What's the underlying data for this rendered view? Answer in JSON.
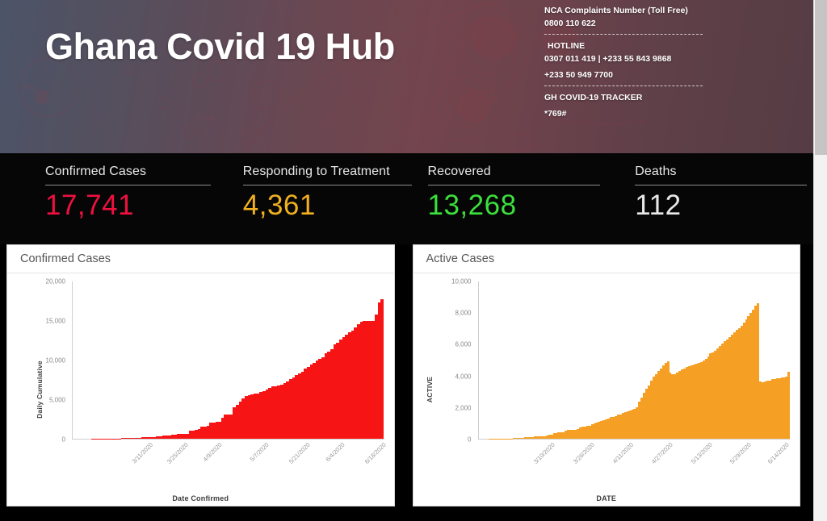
{
  "header": {
    "title": "Ghana Covid 19 Hub",
    "contact": {
      "nca_label": "NCA Complaints Number (Toll Free)",
      "nca_number": "0800 110 622",
      "hotline_label": " HOTLINE",
      "hotline_numbers": "0307 011 419  |    +233 55 843 9868",
      "hotline_extra": "+233 50 949 7700",
      "tracker_label": "GH COVID-19 TRACKER",
      "tracker_code": "*769#"
    }
  },
  "stats": [
    {
      "label": "Confirmed Cases",
      "value": "17,741",
      "color": "#f01040"
    },
    {
      "label": "Responding to Treatment",
      "value": "4,361",
      "color": "#f0b020"
    },
    {
      "label": "Recovered",
      "value": "13,268",
      "color": "#3ce03c"
    },
    {
      "label": "Deaths",
      "value": "112",
      "color": "#e8e8e8"
    }
  ],
  "cards": [
    {
      "title": "Confirmed Cases"
    },
    {
      "title": "Active Cases"
    }
  ],
  "chart_data": [
    {
      "type": "bar",
      "title": "Confirmed Cases",
      "xlabel": "Date Confirmed",
      "ylabel": "Daily Cumulative",
      "ylim": [
        0,
        20000
      ],
      "yticks": [
        "0",
        "5,000",
        "10,000",
        "15,000",
        "20,000"
      ],
      "ytick_values": [
        0,
        5000,
        10000,
        15000,
        20000
      ],
      "xticks": [
        "3/11/2020",
        "3/25/2020",
        "4/9/2020",
        "5/7/2020",
        "5/21/2020",
        "6/4/2020",
        "6/18/2020"
      ],
      "xtick_positions": [
        0.035,
        0.165,
        0.3,
        0.475,
        0.615,
        0.755,
        0.895
      ],
      "grid": false,
      "legend": false,
      "color": "#f61414",
      "values": [
        2,
        3,
        4,
        6,
        7,
        8,
        9,
        11,
        12,
        16,
        19,
        21,
        24,
        27,
        33,
        40,
        53,
        68,
        93,
        108,
        132,
        141,
        152,
        161,
        168,
        195,
        205,
        214,
        287,
        313,
        378,
        408,
        442,
        468,
        494,
        566,
        614,
        636,
        641,
        1042,
        1042,
        1154,
        1279,
        1550,
        1550,
        1671,
        2074,
        2074,
        2169,
        2169,
        2719,
        3091,
        3091,
        3091,
        4012,
        4263,
        4700,
        5127,
        5408,
        5530,
        5638,
        5735,
        5735,
        5918,
        6096,
        6269,
        6486,
        6617,
        6683,
        6808,
        6864,
        7117,
        7303,
        7616,
        7768,
        8070,
        8297,
        8548,
        8885,
        9168,
        9462,
        9638,
        9910,
        10201,
        10358,
        10856,
        11118,
        11422,
        11964,
        12193,
        12590,
        12929,
        13203,
        13556,
        13717,
        14154,
        14568,
        14883,
        15013,
        15013,
        15013,
        15013,
        15834,
        17351,
        17741
      ]
    },
    {
      "type": "bar",
      "title": "Active Cases",
      "xlabel": "DATE",
      "ylabel": "ACTIVE",
      "ylim": [
        0,
        10000
      ],
      "yticks": [
        "0",
        "2,000",
        "4,000",
        "6,000",
        "8,000",
        "10,000"
      ],
      "ytick_values": [
        0,
        2000,
        4000,
        6000,
        8000,
        10000
      ],
      "xticks": [
        "3/10/2020",
        "3/26/2020",
        "4/11/2020",
        "4/27/2020",
        "5/13/2020",
        "5/29/2020",
        "6/14/2020"
      ],
      "xtick_positions": [
        0.02,
        0.165,
        0.31,
        0.455,
        0.6,
        0.745,
        0.885
      ],
      "grid": false,
      "legend": false,
      "color": "#f5a024",
      "values": [
        1,
        2,
        3,
        4,
        6,
        7,
        9,
        11,
        12,
        14,
        16,
        19,
        21,
        24,
        28,
        33,
        40,
        52,
        66,
        85,
        100,
        118,
        126,
        134,
        141,
        146,
        170,
        178,
        186,
        252,
        276,
        336,
        361,
        390,
        412,
        432,
        497,
        540,
        558,
        560,
        560,
        620,
        700,
        765,
        790,
        800,
        810,
        900,
        980,
        1010,
        1060,
        1120,
        1180,
        1240,
        1300,
        1360,
        1400,
        1450,
        1520,
        1560,
        1620,
        1700,
        1760,
        1800,
        1860,
        1900,
        1980,
        2340,
        2600,
        2900,
        3200,
        3400,
        3700,
        3950,
        4100,
        4300,
        4450,
        4650,
        4820,
        4900,
        4200,
        4080,
        4120,
        4200,
        4300,
        4400,
        4480,
        4550,
        4620,
        4680,
        4720,
        4760,
        4820,
        4880,
        4950,
        5100,
        5250,
        5420,
        5480,
        5600,
        5750,
        5900,
        6050,
        6200,
        6300,
        6450,
        6600,
        6750,
        6900,
        7050,
        7200,
        7400,
        7600,
        7800,
        8000,
        8200,
        8450,
        8600,
        3620,
        3600,
        3620,
        3680,
        3700,
        3780,
        3820,
        3850,
        3870,
        3900,
        3900,
        3950,
        4250
      ]
    }
  ]
}
